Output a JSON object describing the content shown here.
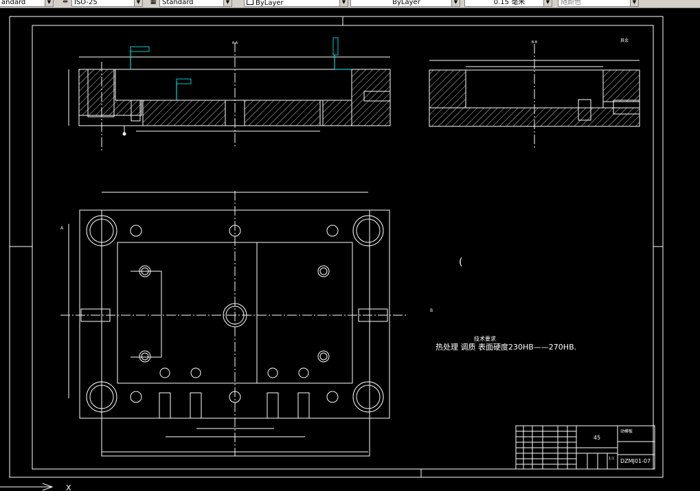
{
  "toolbar": {
    "text_style": "andard",
    "dim_style": "ISO-25",
    "table_style": "Standard",
    "layer": "ByLayer",
    "linetype": "ByLayer",
    "lineweight": "0.15 毫米",
    "plot_style": "随颜色"
  },
  "drawing": {
    "section_label_1": "A-A",
    "section_label_2": "B-B",
    "roughness_note": "其余",
    "tech_req_title": "技术要求",
    "tech_req_line": "热处理 调质 表面硬度230HB——270HB.",
    "material": "45",
    "part_name": "动模板",
    "drawing_number": "DZMJ01-07",
    "scale": "1:1",
    "section_mark_a": "A",
    "section_mark_b": "B"
  },
  "colors": {
    "background": "#000000",
    "lines": "#ffffff",
    "annotation": "#00ffff",
    "title_text": "#ffffff"
  }
}
